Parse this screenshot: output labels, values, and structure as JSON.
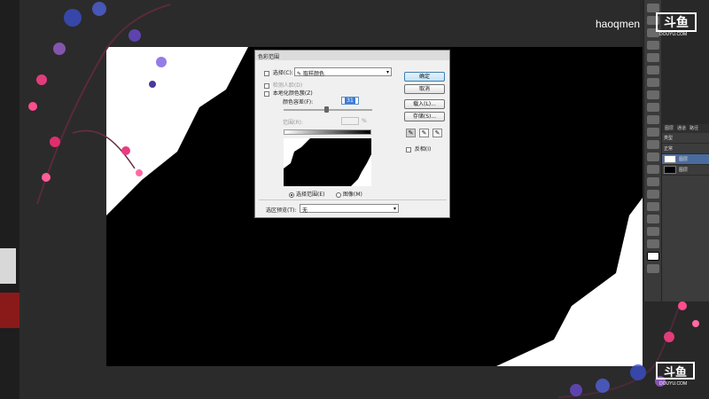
{
  "overlay": {
    "username": "haoqmen",
    "logo_top": {
      "mark": "斗鱼",
      "sub": "DOUYU.COM"
    },
    "logo_bottom": {
      "mark": "斗鱼",
      "sub": "DOUYU.COM"
    }
  },
  "dialog": {
    "title": "色彩范围",
    "select_label": "选择(C):",
    "select_value": "取样颜色",
    "detect_faces_label": "检测人脸(D)",
    "localized_label": "本地化颜色簇(Z)",
    "fuzziness_label": "颜色容差(F):",
    "fuzziness_value": "31",
    "range_label": "范围(R):",
    "range_unit": "%",
    "radio_selection": "选择范围(E)",
    "radio_image": "图像(M)",
    "preview_label": "选区预览(T):",
    "preview_value": "无",
    "buttons": {
      "ok": "确定",
      "cancel": "取消",
      "load": "载入(L)...",
      "save": "存储(S)..."
    },
    "invert_label": "反相(I)"
  },
  "layers_panel": {
    "tabs": [
      "图层",
      "通道",
      "路径"
    ],
    "kind_label": "类型",
    "blend": "正常",
    "layers": [
      {
        "name": "图层"
      },
      {
        "name": "图层"
      }
    ]
  }
}
